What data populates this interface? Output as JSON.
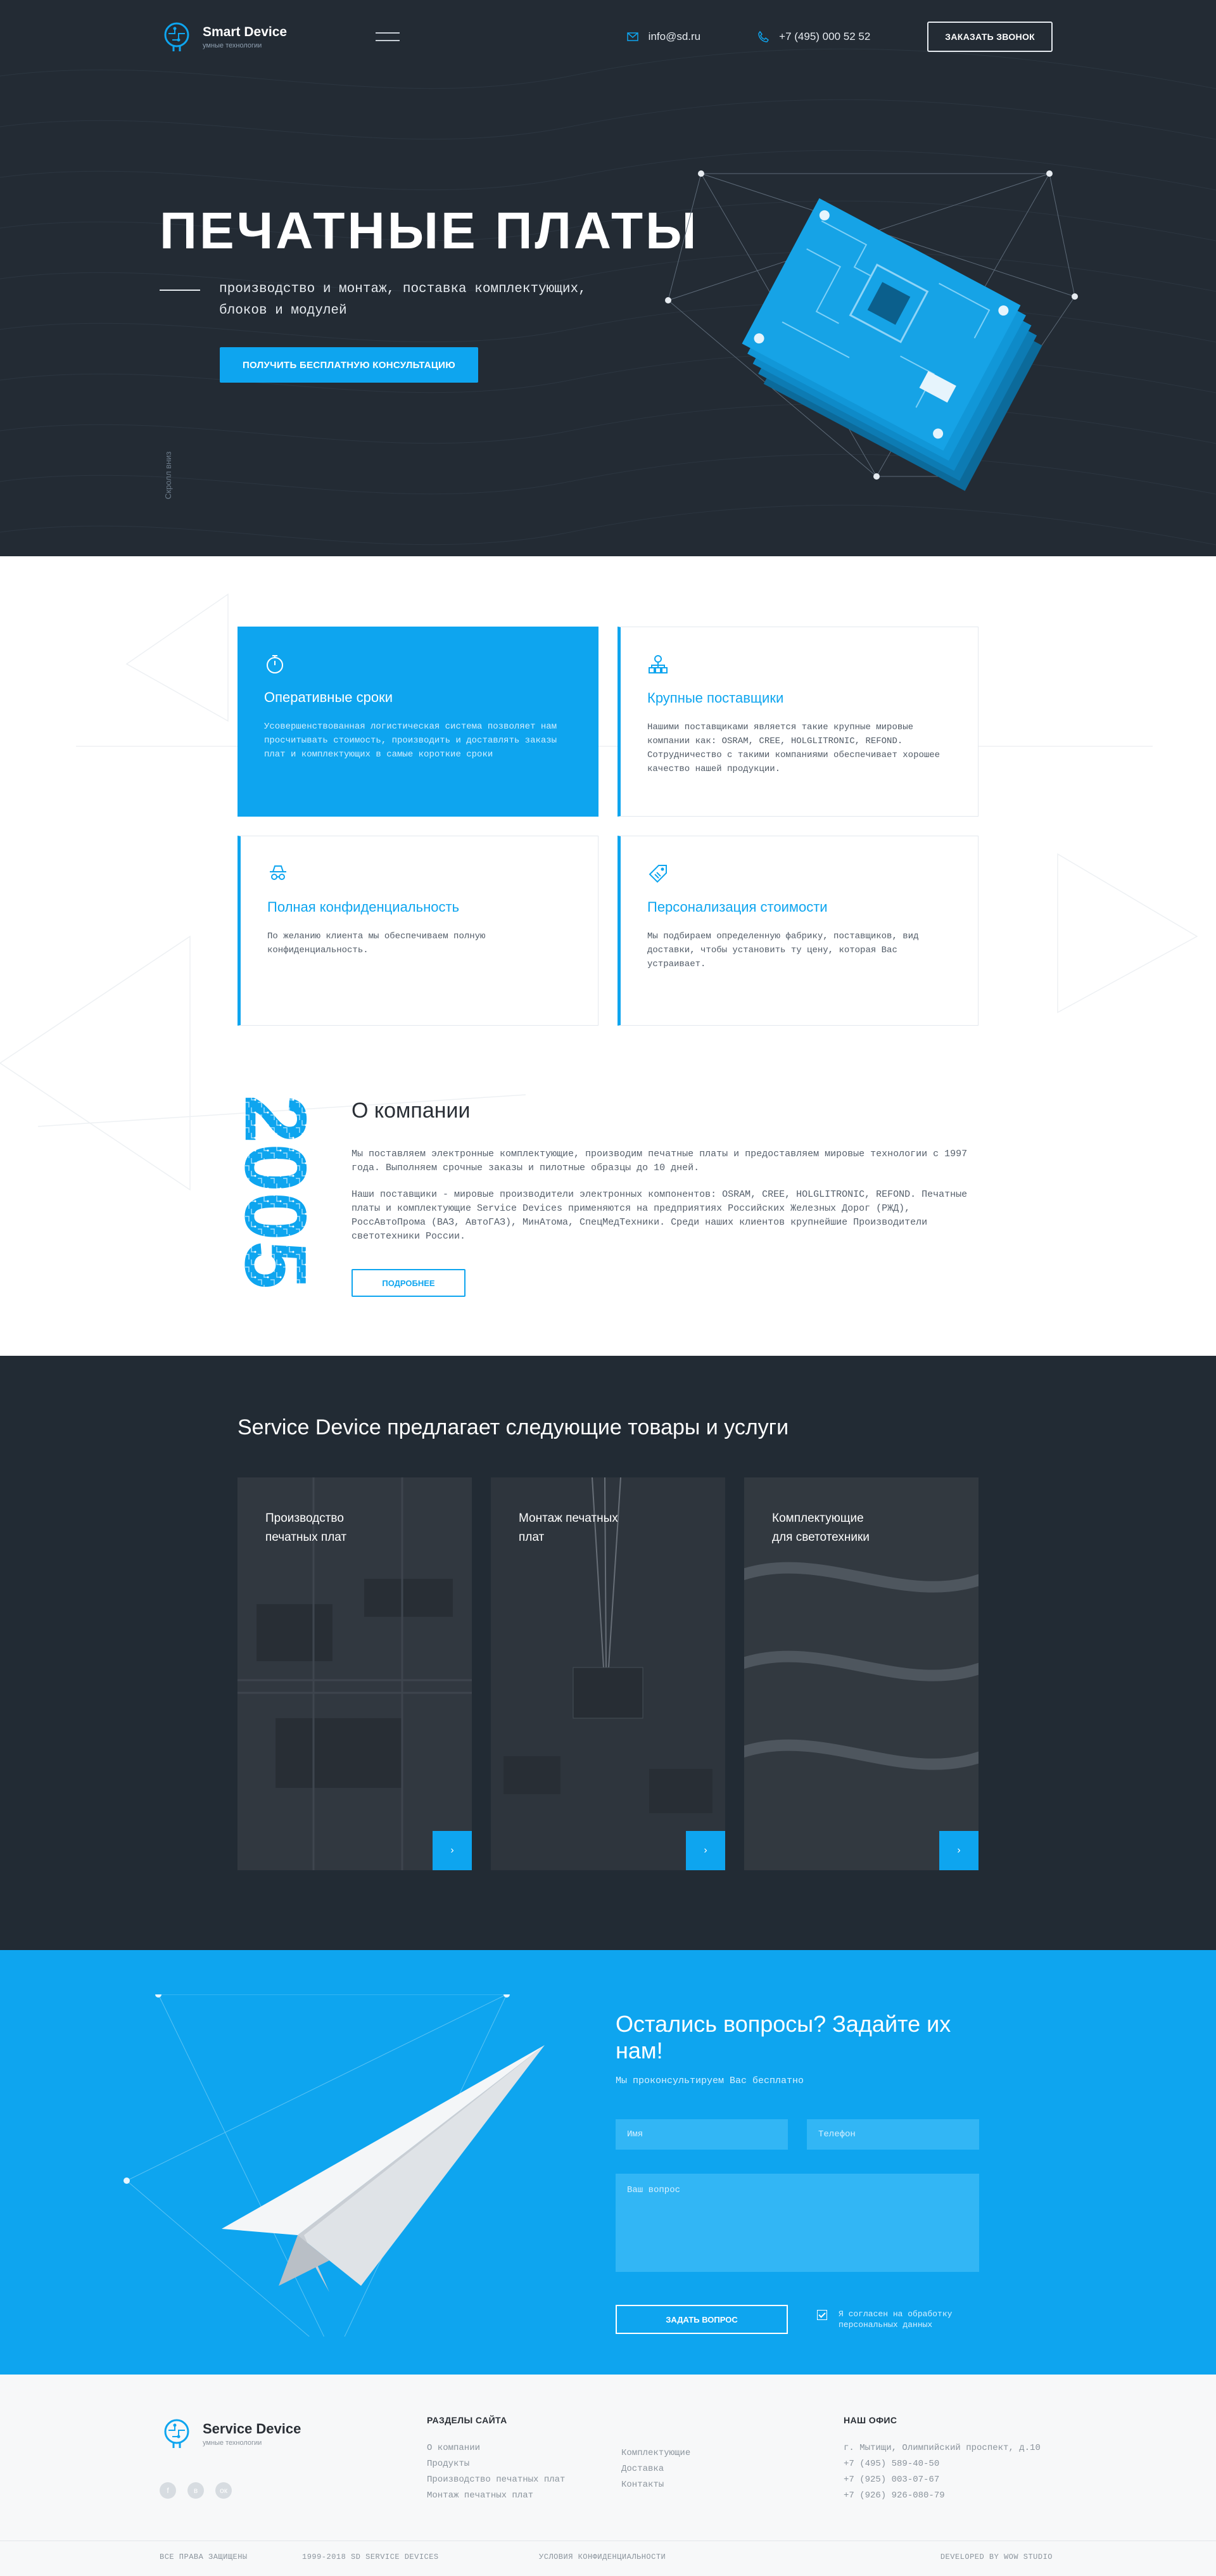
{
  "header": {
    "brand": "Smart Device",
    "tagline": "умные технологии",
    "email": "info@sd.ru",
    "phone": "+7 (495) 000 52 52",
    "callback_button": "ЗАКАЗАТЬ ЗВОНОК"
  },
  "hero": {
    "title": "ПЕЧАТНЫЕ ПЛАТЫ",
    "subtitle": "производство и монтаж, поставка комплектующих, блоков и модулей",
    "cta": "ПОЛУЧИТЬ БЕСПЛАТНУЮ КОНСУЛЬТАЦИЮ",
    "scroll_label": "Скролл вниз"
  },
  "features": [
    {
      "icon": "stopwatch-icon",
      "title": "Оперативные сроки",
      "text": "Усовершенствованная логистическая система позволяет нам просчитывать стоимость, производить и доставлять заказы плат и комплектующих в самые короткие сроки"
    },
    {
      "icon": "network-icon",
      "title": "Крупные поставщики",
      "text": "Нашими поставщиками является такие крупные мировые компании как: OSRAM, CREE, HOLGLITRONIC, REFOND. Сотрудничество с такими компаниями обеспечивает хорошее качество нашей продукции."
    },
    {
      "icon": "spy-icon",
      "title": "Полная конфиденциальность",
      "text": "По желанию клиента  мы обеспечиваем полную конфиденциальность."
    },
    {
      "icon": "price-tag-icon",
      "title": "Персонализация стоимости",
      "text": "Мы  подбираем определенную фабрику, поставщиков, вид доставки, чтобы установить ту цену, которая Вас устраивает."
    }
  ],
  "about": {
    "year": "2005",
    "title": "О компании",
    "p1": "Мы поставляем электронные комплектующие, производим печатные платы и предоставляем мировые технологии с 1997 года. Выполняем срочные заказы и пилотные образцы до 10 дней.",
    "p2": "Наши поставщики - мировые производители электронных компонентов: OSRAM, CREE, HOLGLITRONIC, REFOND. Печатные платы и комплектующие Service Devices применяются на предприятиях Российских Железных Дорог (РЖД), РоссАвтоПрома (ВАЗ, АвтоГАЗ), МинАтома, СпецМедТехники. Среди наших клиентов крупнейшие Производители светотехники России.",
    "button": "ПОДРОБНЕЕ"
  },
  "services": {
    "title": "Service Device предлагает следующие товары и услуги",
    "items": [
      {
        "line1": "Производство",
        "line2": "печатных плат",
        "arrow": "›"
      },
      {
        "line1": "Монтаж печатных",
        "line2": "плат",
        "arrow": "›"
      },
      {
        "line1": "Комплектующие",
        "line2": "для светотехники",
        "arrow": "›"
      }
    ]
  },
  "contact": {
    "title": "Остались вопросы? Задайте их нам!",
    "lead": "Мы проконсультируем Вас бесплатно",
    "name_placeholder": "Имя",
    "phone_placeholder": "Телефон",
    "question_placeholder": "Ваш вопрос",
    "submit": "ЗАДАТЬ ВОПРОС",
    "consent": "Я согласен на обработку персональных данных"
  },
  "footer": {
    "brand": "Service Device",
    "tagline": "умные технологии",
    "social": [
      "f",
      "в",
      "ок"
    ],
    "sections_title": "РАЗДЕЛЫ САЙТА",
    "links_col1": [
      "О компании",
      "Продукты",
      "Производство печатных плат",
      "Монтаж печатных плат"
    ],
    "links_col2": [
      "Комплектующие",
      "Доставка",
      "Контакты"
    ],
    "office_title": "НАШ ОФИС",
    "office": [
      "г. Мытищи, Олимпийский проспект, д.10",
      "+7 (495) 589-40-50",
      "+7 (925) 003-07-67",
      "+7 (926) 926-080-79"
    ],
    "rights": "ВСЕ ПРАВА ЗАЩИЩЕНЫ",
    "copyright": "1999-2018 SD SERVICE DEVICES",
    "privacy": "УСЛОВИЯ КОНФИДЕНЦИАЛЬНОСТИ",
    "developer": "DEVELOPED BY WOW STUDIO"
  },
  "colors": {
    "accent": "#0ea5ef",
    "dark": "#232b34"
  }
}
